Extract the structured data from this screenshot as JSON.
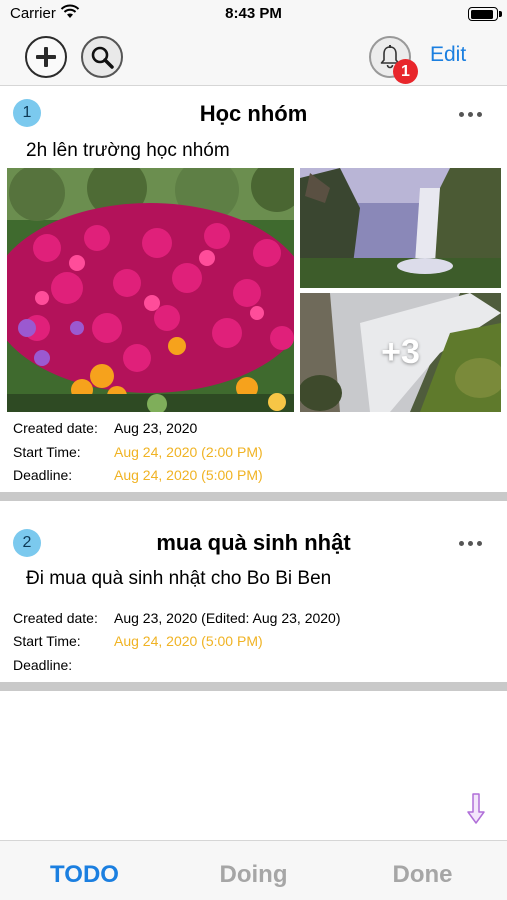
{
  "status_bar": {
    "carrier": "Carrier",
    "time": "8:43 PM"
  },
  "nav": {
    "add_icon": "plus-circle-icon",
    "search_icon": "magnifier-icon",
    "bell_icon": "bell-icon",
    "notification_count": "1",
    "edit_label": "Edit"
  },
  "cards": [
    {
      "index": "1",
      "title": "Học nhóm",
      "description": "2h lên trường học nhóm",
      "extra_images": "+3",
      "created_label": "Created date:",
      "created_value": "Aug 23, 2020",
      "start_label": "Start Time:",
      "start_value": "Aug 24, 2020  (2:00 PM)",
      "deadline_label": "Deadline:",
      "deadline_value": "Aug 24, 2020  (5:00 PM)"
    },
    {
      "index": "2",
      "title": "mua quà sinh nhật",
      "description": "Đi mua quà sinh nhật cho Bo Bi Ben",
      "created_label": "Created date:",
      "created_value": "Aug 23, 2020  (Edited: Aug 23, 2020)",
      "start_label": "Start Time:",
      "start_value": "Aug 24, 2020  (5:00 PM)",
      "deadline_label": "Deadline:",
      "deadline_value": ""
    }
  ],
  "tabs": [
    {
      "label": "TODO",
      "active": true
    },
    {
      "label": "Doing",
      "active": false
    },
    {
      "label": "Done",
      "active": false
    }
  ],
  "colors": {
    "accent": "#1b7fe0",
    "date_orange": "#f0b324",
    "badge": "#e8262b",
    "index_circle": "#7bc9ee"
  }
}
